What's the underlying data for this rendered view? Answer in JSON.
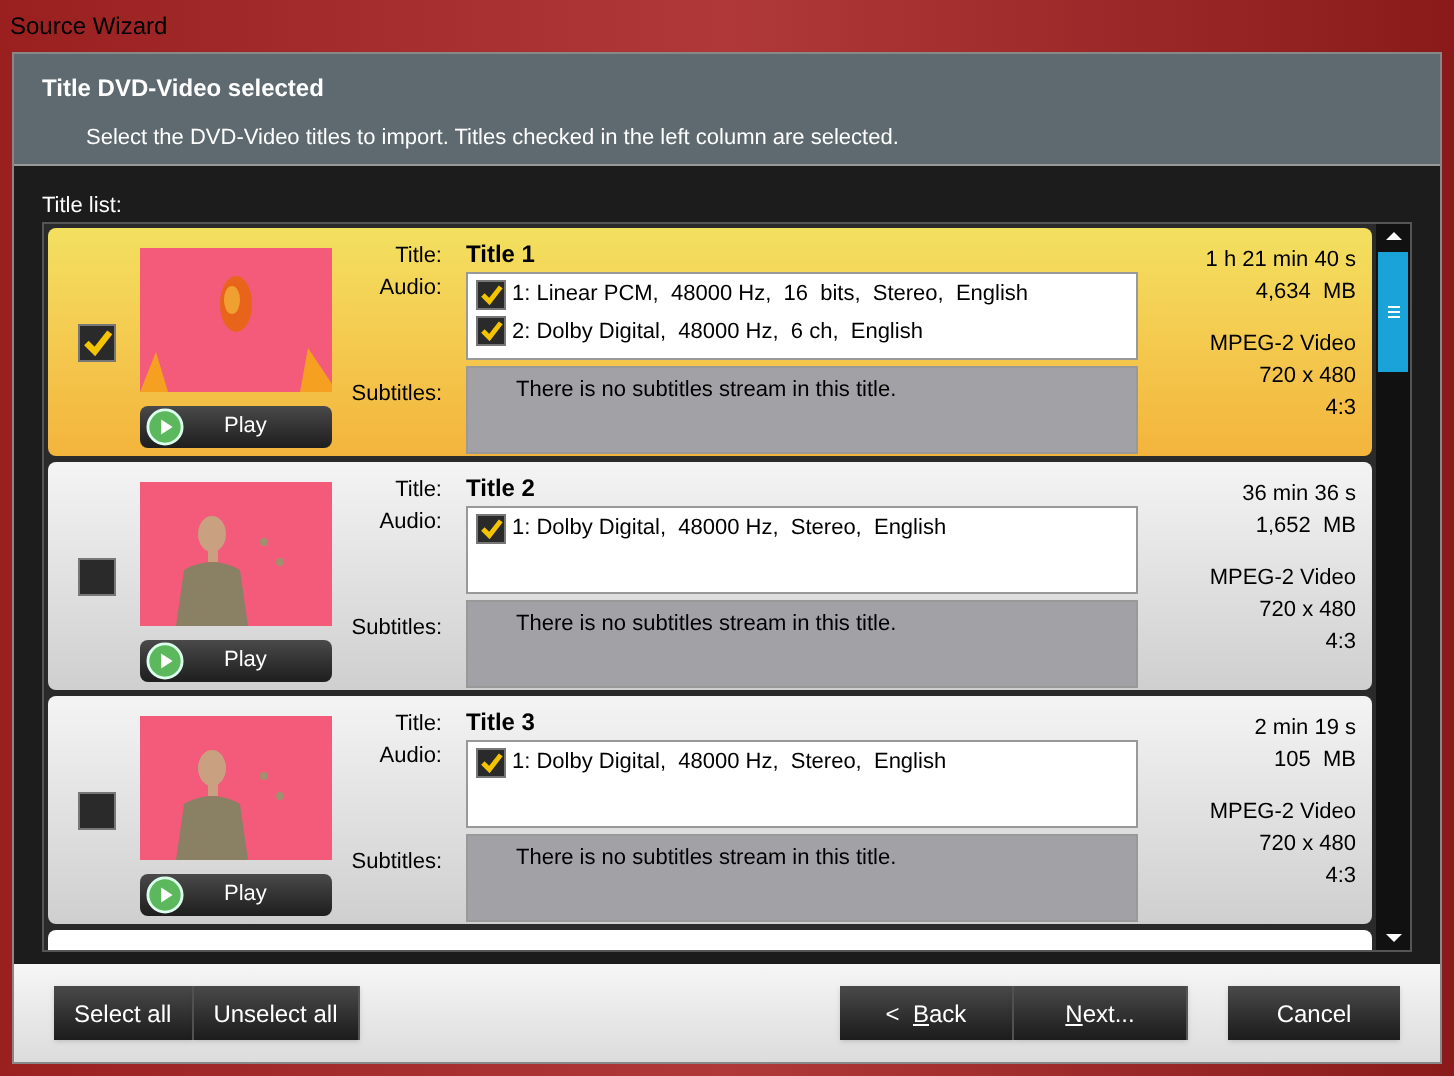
{
  "window": {
    "title": "Source Wizard"
  },
  "header": {
    "title": "Title DVD-Video selected",
    "description": "Select the DVD-Video titles to import. Titles checked in the left column are selected."
  },
  "list_label": "Title list:",
  "titles": [
    {
      "selected": true,
      "checked": true,
      "play": "Play",
      "title_label": "Title:",
      "audio_label": "Audio:",
      "subtitles_label": "Subtitles:",
      "title": "Title 1",
      "audio": [
        {
          "label": "1: Linear PCM,  48000 Hz,  16  bits,  Stereo,  English",
          "checked": true
        },
        {
          "label": "2: Dolby Digital,  48000 Hz,  6 ch,  English",
          "checked": true
        }
      ],
      "subtitles": "There is no subtitles stream in this title.",
      "duration": "1 h 21 min 40 s",
      "size": "4,634  MB",
      "format": "MPEG-2 Video",
      "resolution": "720 x 480",
      "aspect": "4:3"
    },
    {
      "selected": false,
      "checked": false,
      "play": "Play",
      "title_label": "Title:",
      "audio_label": "Audio:",
      "subtitles_label": "Subtitles:",
      "title": "Title 2",
      "audio": [
        {
          "label": "1: Dolby Digital,  48000 Hz,  Stereo,  English",
          "checked": true
        }
      ],
      "subtitles": "There is no subtitles stream in this title.",
      "duration": "36 min 36 s",
      "size": "1,652  MB",
      "format": "MPEG-2 Video",
      "resolution": "720 x 480",
      "aspect": "4:3"
    },
    {
      "selected": false,
      "checked": false,
      "play": "Play",
      "title_label": "Title:",
      "audio_label": "Audio:",
      "subtitles_label": "Subtitles:",
      "title": "Title 3",
      "audio": [
        {
          "label": "1: Dolby Digital,  48000 Hz,  Stereo,  English",
          "checked": true
        }
      ],
      "subtitles": "There is no subtitles stream in this title.",
      "duration": "2 min 19 s",
      "size": "105  MB",
      "format": "MPEG-2 Video",
      "resolution": "720 x 480",
      "aspect": "4:3"
    }
  ],
  "buttons_left": [
    {
      "label": "Select all"
    },
    {
      "label": "Unselect all"
    }
  ],
  "buttons_nav": [
    {
      "before": "<  ",
      "mnemonic": "B",
      "after": "ack"
    },
    {
      "mnemonic": "N",
      "after": "ext..."
    }
  ],
  "cancel": {
    "label": "Cancel"
  }
}
